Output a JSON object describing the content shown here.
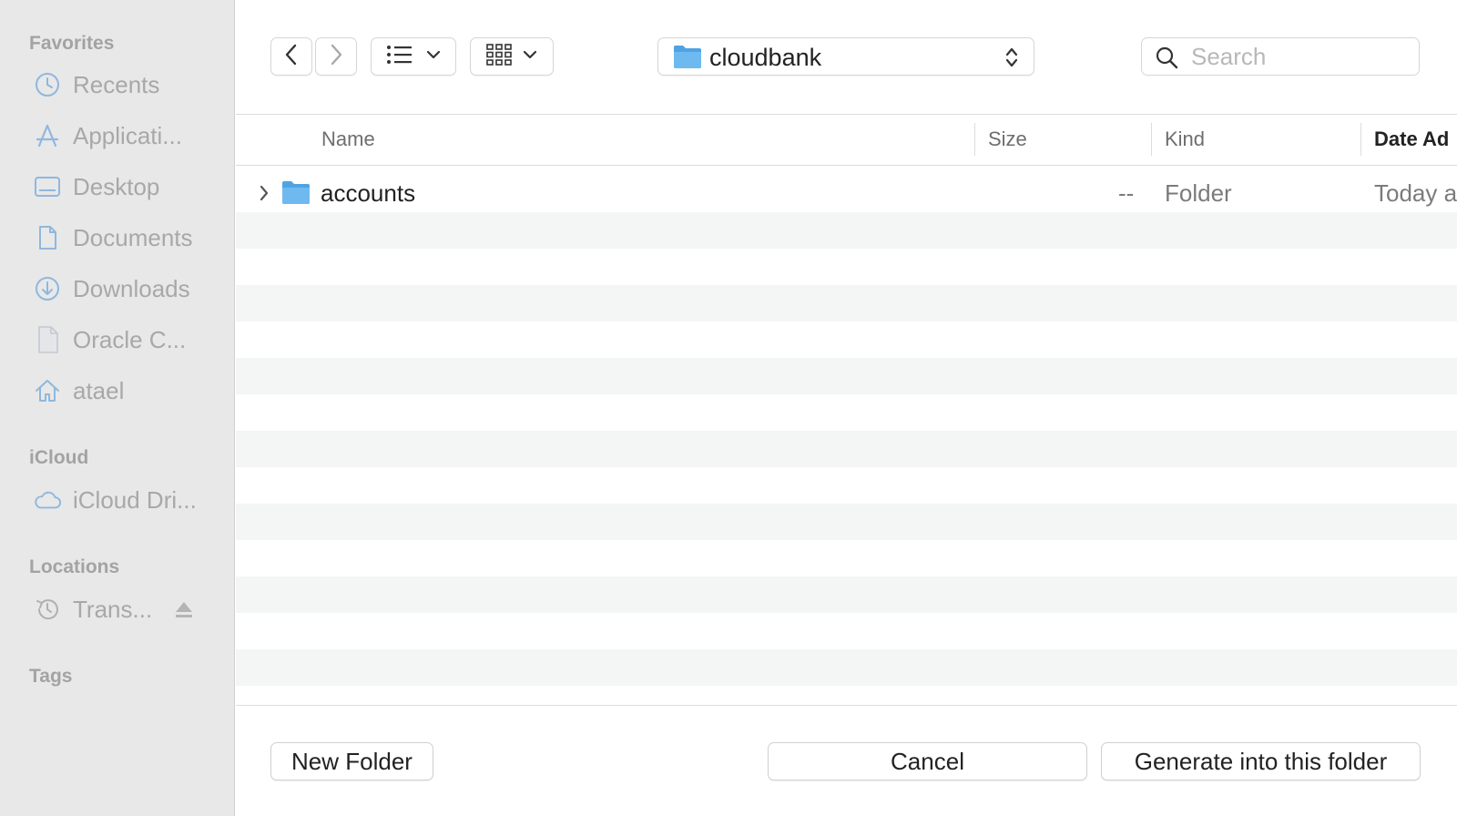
{
  "sidebar": {
    "sections": [
      {
        "heading": "Favorites"
      },
      {
        "heading": "iCloud"
      },
      {
        "heading": "Locations"
      },
      {
        "heading": "Tags"
      }
    ],
    "favorites": [
      {
        "label": "Recents",
        "icon": "clock-icon"
      },
      {
        "label": "Applicati...",
        "icon": "applications-icon"
      },
      {
        "label": "Desktop",
        "icon": "desktop-icon"
      },
      {
        "label": "Documents",
        "icon": "document-icon"
      },
      {
        "label": "Downloads",
        "icon": "download-icon"
      },
      {
        "label": "Oracle C...",
        "icon": "file-icon"
      },
      {
        "label": "atael",
        "icon": "home-icon"
      }
    ],
    "icloud": [
      {
        "label": "iCloud Dri...",
        "icon": "cloud-icon"
      }
    ],
    "locations": [
      {
        "label": "Trans...",
        "icon": "time-machine-icon"
      }
    ]
  },
  "toolbar": {
    "path": "cloudbank",
    "search_placeholder": "Search"
  },
  "columns": {
    "name": "Name",
    "size": "Size",
    "kind": "Kind",
    "date_added": "Date Ad"
  },
  "rows": [
    {
      "name": "accounts",
      "size": "--",
      "kind": "Folder",
      "date": "Today a"
    }
  ],
  "footer": {
    "new_folder": "New Folder",
    "cancel": "Cancel",
    "confirm": "Generate into this folder"
  },
  "colors": {
    "accent": "#5aa7e6",
    "sidebar_bg": "#e8e8e8",
    "stripe": "#f4f5f5"
  }
}
